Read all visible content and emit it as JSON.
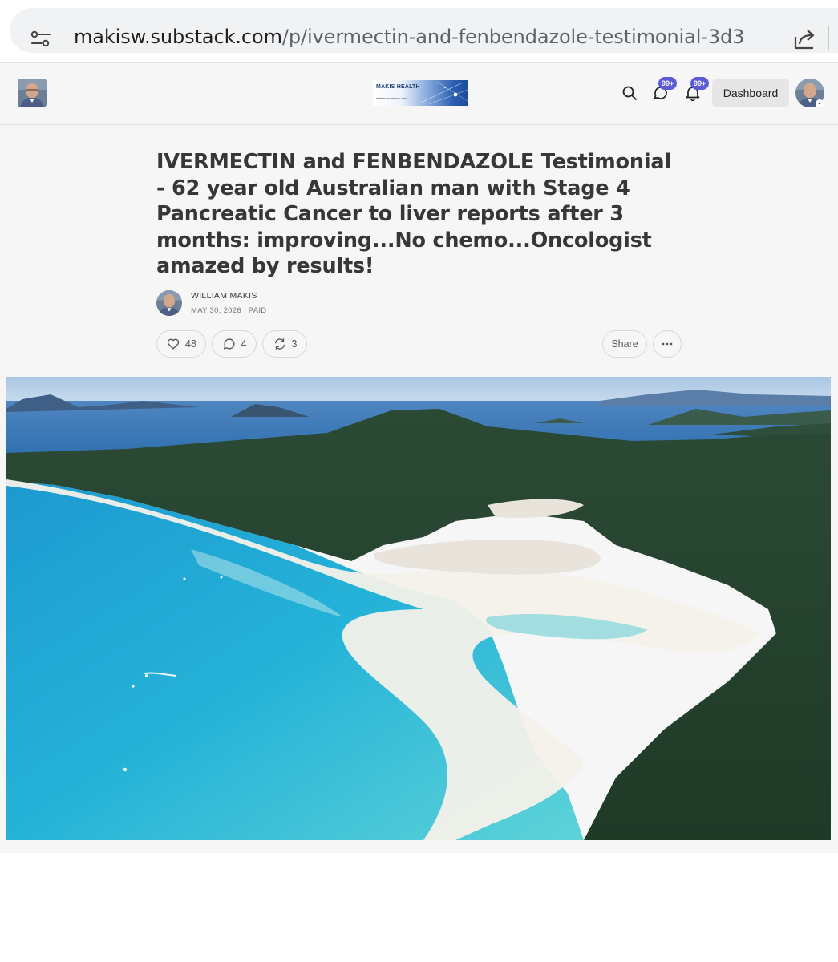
{
  "browser": {
    "url_host": "makisw.substack.com",
    "url_path": "/p/ivermectin-and-fenbendazole-testimonial-3d3"
  },
  "header": {
    "logo_title": "MAKIS HEALTH",
    "logo_subtitle": "makisw.substack.com",
    "chat_badge": "99+",
    "notifications_badge": "99+",
    "dashboard_label": "Dashboard"
  },
  "article": {
    "title": "IVERMECTIN and FENBENDAZOLE Testimonial - 62 year old Australian man with Stage 4 Pancreatic Cancer to liver reports after 3 months: improving...No chemo...Oncologist amazed by results!",
    "author": "WILLIAM MAKIS",
    "date": "MAY 30, 2026",
    "access": "PAID",
    "likes": "48",
    "comments": "4",
    "restacks": "3",
    "share_label": "Share"
  },
  "colors": {
    "badge": "#5b5bd6",
    "title": "#363737",
    "page_bg": "#f6f6f6"
  },
  "icons": [
    "tune-icon",
    "share-page-icon",
    "search-icon",
    "chat-icon",
    "bell-icon",
    "heart-icon",
    "comment-icon",
    "restack-icon",
    "more-icon",
    "chevron-down-icon"
  ]
}
